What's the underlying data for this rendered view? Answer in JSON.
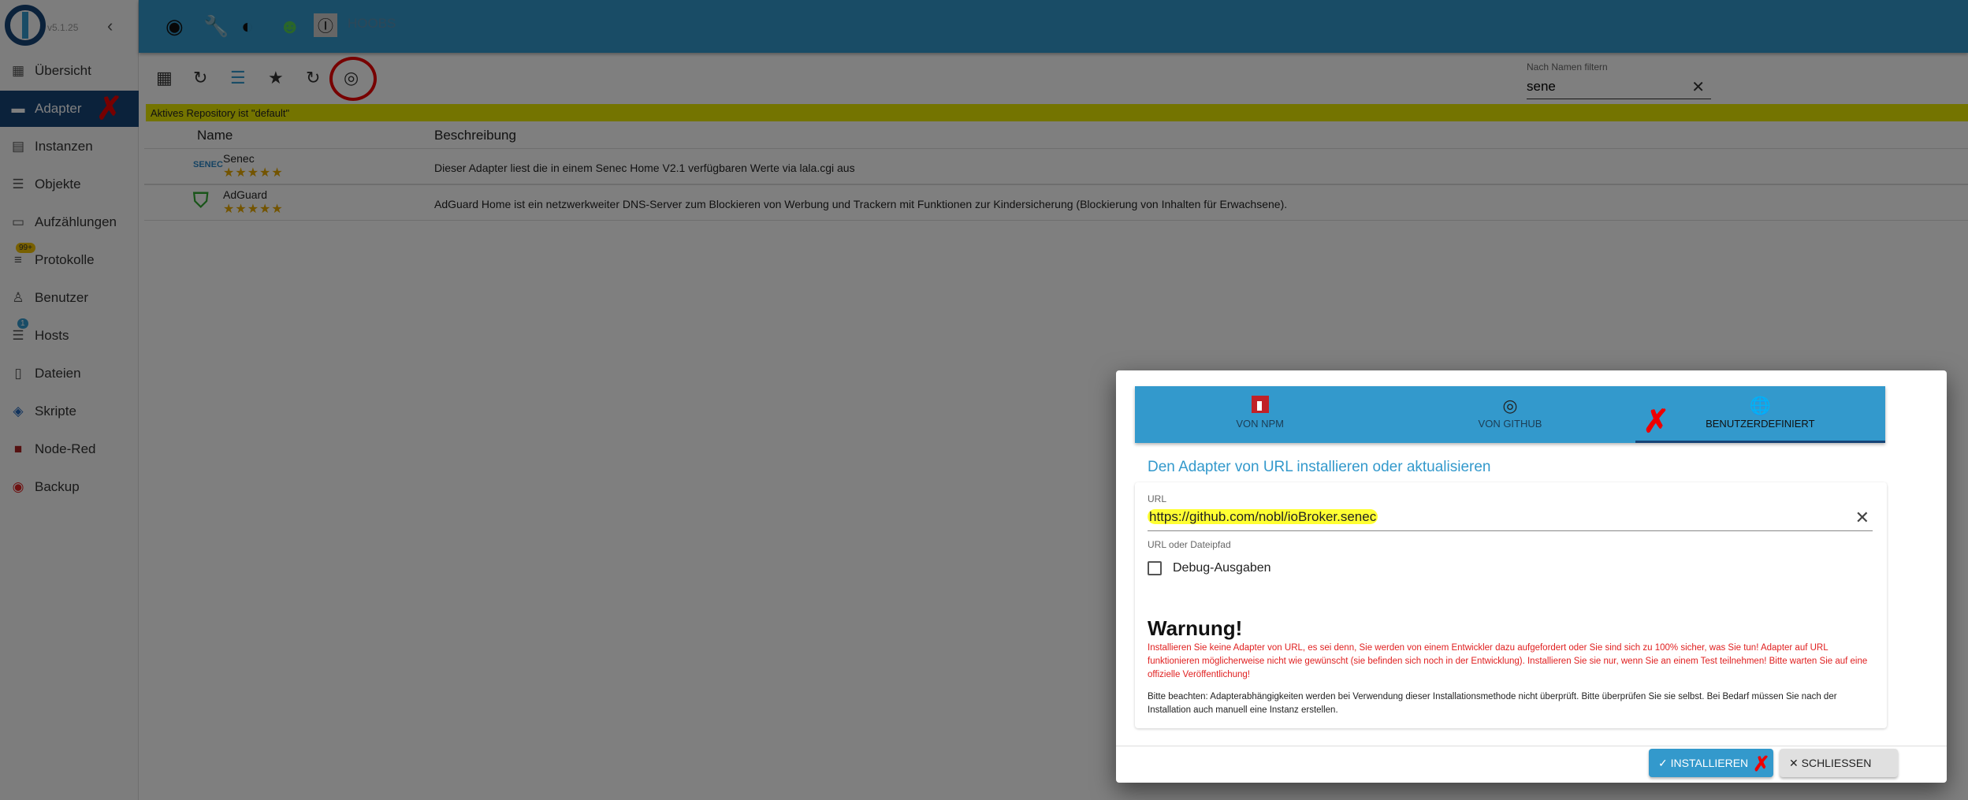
{
  "app": {
    "version": "v5.1.25",
    "header_link": "HOOBS"
  },
  "sidebar": {
    "items": [
      {
        "label": "Übersicht",
        "icon": "grid-icon"
      },
      {
        "label": "Adapter",
        "icon": "store-icon",
        "active": true
      },
      {
        "label": "Instanzen",
        "icon": "instances-icon"
      },
      {
        "label": "Objekte",
        "icon": "list-icon"
      },
      {
        "label": "Aufzählungen",
        "icon": "enum-icon"
      },
      {
        "label": "Protokolle",
        "icon": "log-icon",
        "badge": "99+"
      },
      {
        "label": "Benutzer",
        "icon": "user-icon"
      },
      {
        "label": "Hosts",
        "icon": "hosts-icon",
        "badge": "1"
      },
      {
        "label": "Dateien",
        "icon": "files-icon"
      },
      {
        "label": "Skripte",
        "icon": "script-icon"
      },
      {
        "label": "Node-Red",
        "icon": "node-red-icon"
      },
      {
        "label": "Backup",
        "icon": "backup-icon"
      }
    ]
  },
  "filter": {
    "label": "Nach Namen filtern",
    "value": "sene"
  },
  "repo_notice": "Aktives Repository ist \"default\"",
  "table": {
    "headers": [
      "Name",
      "Beschreibung"
    ],
    "rows": [
      {
        "name": "Senec",
        "logo": "SENEC",
        "rating": 5,
        "description": "Dieser Adapter liest die in einem Senec Home V2.1 verfügbaren Werte via lala.cgi aus"
      },
      {
        "name": "AdGuard",
        "logo": "adguard-shield",
        "rating": 5,
        "description": "AdGuard Home ist ein netzwerkweiter DNS-Server zum Blockieren von Werbung und Trackern mit Funktionen zur Kindersicherung (Blockierung von Inhalten für Erwachsene)."
      }
    ]
  },
  "dialog": {
    "tabs": [
      {
        "label": "VON NPM",
        "icon": "npm-icon"
      },
      {
        "label": "VON GITHUB",
        "icon": "github-icon"
      },
      {
        "label": "BENUTZERDEFINIERT",
        "icon": "globe-icon",
        "active": true
      }
    ],
    "subtitle": "Den Adapter von URL installieren oder aktualisieren",
    "url_label": "URL",
    "url_value": "https://github.com/nobl/ioBroker.senec",
    "url_help": "URL oder Dateipfad",
    "debug_label": "Debug-Ausgaben",
    "debug_checked": false,
    "warning_title": "Warnung!",
    "warning_text": "Installieren Sie keine Adapter von URL, es sei denn, Sie werden von einem Entwickler dazu aufgefordert oder Sie sind sich zu 100% sicher, was Sie tun! Adapter auf URL funktionieren möglicherweise nicht wie gewünscht (sie befinden sich noch in der Entwicklung). Installieren Sie sie nur, wenn Sie an einem Test teilnehmen! Bitte warten Sie auf eine offizielle Veröffentlichung!",
    "note_text": "Bitte beachten: Adapterabhängigkeiten werden bei Verwendung dieser Installationsmethode nicht überprüft. Bitte überprüfen Sie sie selbst. Bei Bedarf müssen Sie nach der Installation auch manuell eine Instanz erstellen.",
    "install_label": "INSTALLIEREN",
    "close_label": "SCHLIESSEN"
  },
  "colors": {
    "primary": "#3399cc",
    "dark": "#164477",
    "warning": "#e02020",
    "highlight": "#ffff33"
  }
}
